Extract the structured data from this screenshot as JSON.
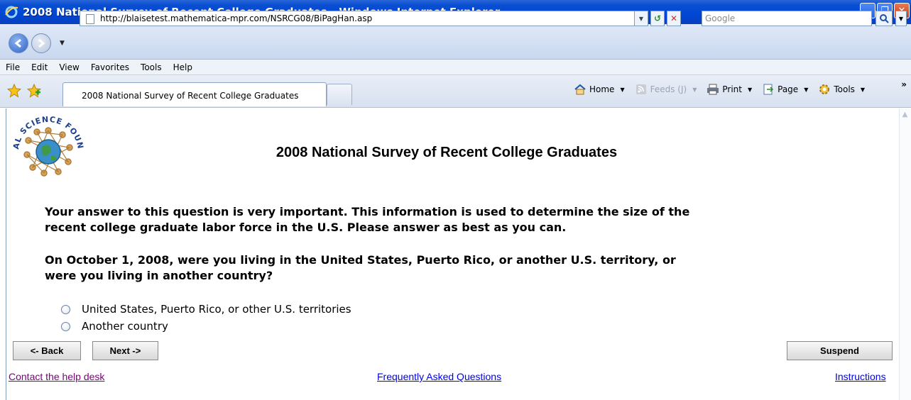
{
  "window": {
    "title": "2008 National Survey of Recent College Graduates - Windows Internet Explorer"
  },
  "address_bar": {
    "url": "http://blaisetest.mathematica-mpr.com/NSRCG08/BiPagHan.asp",
    "search_placeholder": "Google"
  },
  "menu": [
    "File",
    "Edit",
    "View",
    "Favorites",
    "Tools",
    "Help"
  ],
  "tab": {
    "label": "2008 National Survey of Recent College Graduates"
  },
  "commands": {
    "home": "Home",
    "feeds": "Feeds (J)",
    "print": "Print",
    "page": "Page",
    "tools": "Tools"
  },
  "seal": {
    "text": "NATIONAL SCIENCE FOUNDATION"
  },
  "page": {
    "title": "2008 National Survey of Recent College Graduates",
    "intro": "Your answer to this question is very important. This information is used to determine the size of the recent college graduate labor force in the U.S. Please answer as best as you can.",
    "question": "On October 1, 2008, were you living in the United States, Puerto Rico, or another U.S. territory, or were you living in another country?",
    "options": [
      "United States, Puerto Rico, or other U.S. territories",
      "Another country"
    ]
  },
  "buttons": {
    "back": "<- Back",
    "next": "Next ->",
    "suspend": "Suspend"
  },
  "links": {
    "help": "Contact the help desk",
    "faq": "Frequently Asked Questions",
    "instructions": "Instructions"
  }
}
